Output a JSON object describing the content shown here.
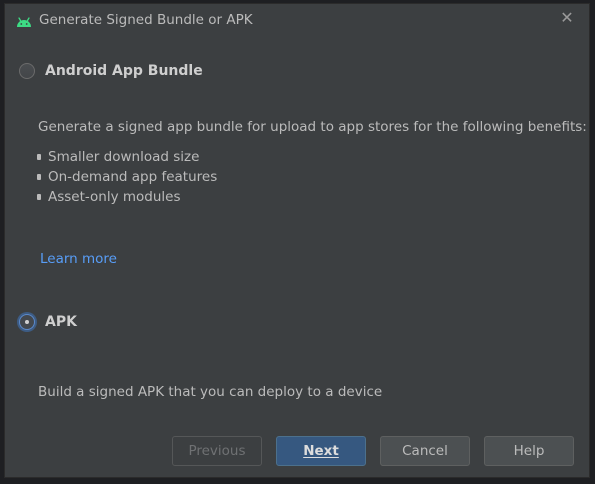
{
  "window": {
    "title": "Generate Signed Bundle or APK",
    "icon": "android-icon",
    "close_glyph": "✕"
  },
  "options": [
    {
      "label": "Android App Bundle",
      "selected": false,
      "description": "Generate a signed app bundle for upload to app stores for the following benefits:",
      "benefits": [
        "Smaller download size",
        "On-demand app features",
        "Asset-only modules"
      ],
      "link": "Learn more"
    },
    {
      "label": "APK",
      "selected": true,
      "description": "Build a signed APK that you can deploy to a device"
    }
  ],
  "buttons": {
    "previous": "Previous",
    "next": "Next",
    "cancel": "Cancel",
    "help": "Help"
  },
  "colors": {
    "dialog_bg": "#3c3f41",
    "accent": "#365880",
    "link": "#589df6",
    "android_green": "#3ddc84"
  }
}
